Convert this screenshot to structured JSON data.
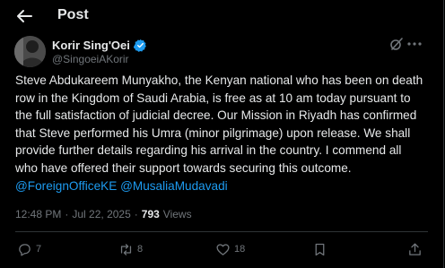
{
  "header": {
    "title": "Post"
  },
  "author": {
    "display_name": "Korir Sing'Oei",
    "handle": "@SingoeiAKorir",
    "verified": true
  },
  "tweet": {
    "text": "Steve Abdukareem Munyakho, the Kenyan national who has been on death row in the Kingdom of Saudi Arabia, is free as at 10 am today pursuant to the full satisfaction of judicial decree. Our Mission in Riyadh has confirmed that Steve performed his Umra (minor pilgrimage) upon release. We shall provide further details regarding his arrival in the country. I commend all who have offered their support towards securing this outcome. ",
    "mention_1": "@ForeignOfficeKE",
    "mention_2": "@MusaliaMudavadi"
  },
  "meta": {
    "time": "12:48 PM",
    "separator": "·",
    "date": "Jul 22, 2025",
    "separator_2": "·",
    "views_count": "793",
    "views_label": "Views"
  },
  "actions": {
    "replies": "7",
    "reposts": "8",
    "likes": "18"
  },
  "colors": {
    "background": "#000000",
    "text": "#e7e9ea",
    "secondary": "#71767b",
    "accent": "#1d9bf0"
  },
  "icons": [
    "back-arrow-icon",
    "verified-badge-icon",
    "grok-icon",
    "more-icon",
    "reply-icon",
    "repost-icon",
    "like-icon",
    "bookmark-icon",
    "share-icon"
  ]
}
